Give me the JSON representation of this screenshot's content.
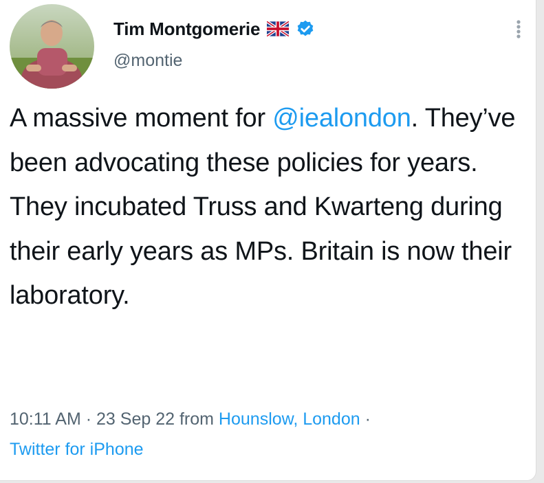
{
  "author": {
    "display_name": "Tim Montgomerie",
    "handle": "@montie",
    "flag_icon": "uk-flag-icon",
    "verified_icon": "verified-badge-icon",
    "verified_color": "#1d9bf0"
  },
  "tweet": {
    "text_before_mention": "A massive moment for ",
    "mention": "@iealondon",
    "text_after_mention": ". They’ve been advocating these policies for years. They incubated Truss and Kwarteng during their early years as MPs. Britain is now their laboratory."
  },
  "meta": {
    "time": "10:11 AM",
    "separator": "·",
    "date": "23 Sep 22",
    "from_label": "from",
    "location": "Hounslow, London",
    "separator2": "·",
    "source": "Twitter for iPhone"
  },
  "colors": {
    "text": "#0f1419",
    "secondary": "#536471",
    "link": "#1d9bf0"
  }
}
